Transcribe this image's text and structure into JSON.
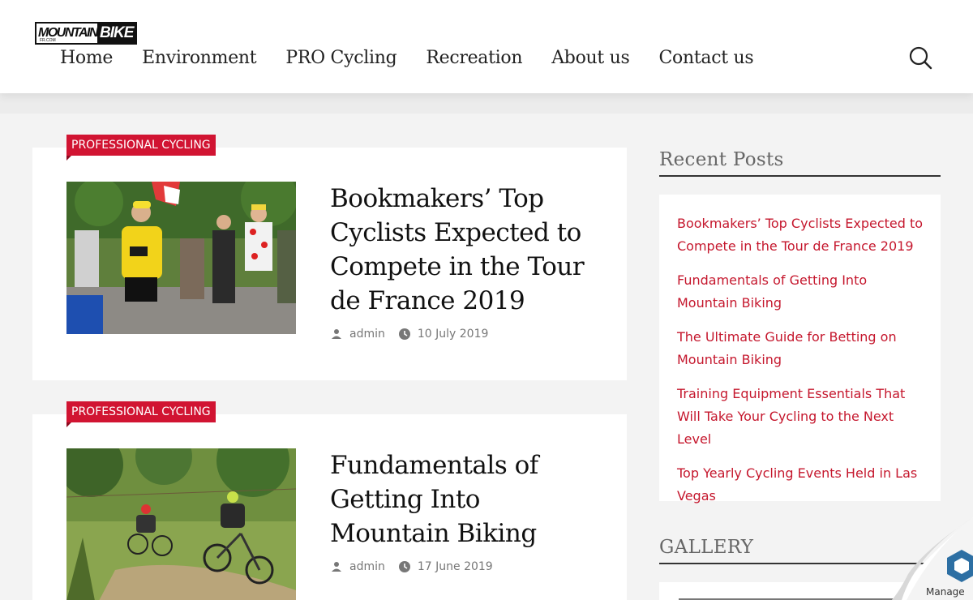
{
  "logo": {
    "part1": "MOUNTAIN",
    "part2": "BIKE",
    "part3": "FR.COM"
  },
  "nav": [
    "Home",
    "Environment",
    "PRO Cycling",
    "Recreation",
    "About us",
    "Contact us"
  ],
  "posts": [
    {
      "category": "PROFESSIONAL CYCLING",
      "title": "Bookmakers’ Top Cyclists Expected to Compete in the Tour de France 2019",
      "author": "admin",
      "date": "10 July 2019"
    },
    {
      "category": "PROFESSIONAL CYCLING",
      "title": "Fundamentals of Getting Into Mountain Biking",
      "author": "admin",
      "date": "17 June 2019"
    }
  ],
  "sidebar": {
    "recent_title": "Recent Posts",
    "recent_posts": [
      "Bookmakers’ Top Cyclists Expected to Compete in the Tour de France 2019",
      "Fundamentals of Getting Into Mountain Biking",
      "The Ultimate Guide for Betting on Mountain Biking",
      "Training Equipment Essentials That Will Take Your Cycling to the Next Level",
      "Top Yearly Cycling Events Held in Las Vegas"
    ],
    "gallery_title": "GALLERY"
  },
  "manage": {
    "label": "Manage"
  },
  "colors": {
    "accent": "#d11432",
    "link": "#c5172d",
    "background": "#f3f3f3"
  }
}
